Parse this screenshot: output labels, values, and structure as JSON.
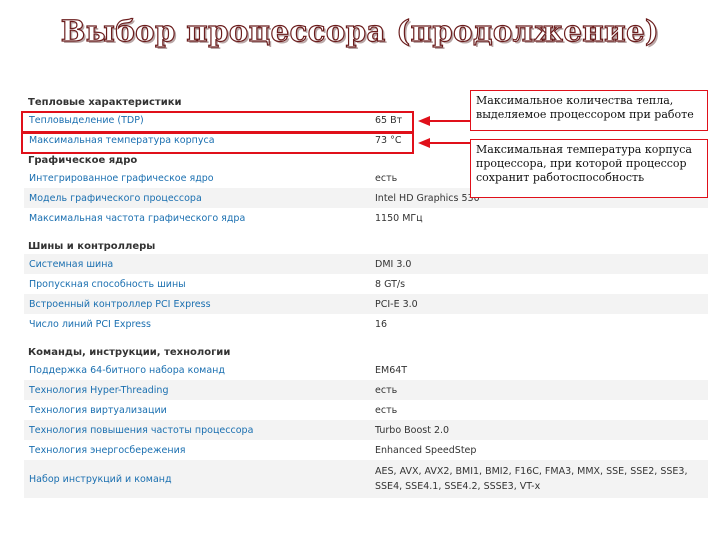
{
  "slide": {
    "title": "Выбор процессора (продолжение)"
  },
  "callouts": [
    {
      "text": "Максимальное количества тепла, выделяемое процессором при работе"
    },
    {
      "text": "Максимальная температура корпуса процессора, при которой процессор сохранит работоспособность"
    }
  ],
  "spec": {
    "thermal": {
      "header": "Тепловые характеристики",
      "rows": [
        {
          "name": "Тепловыделение (TDP)",
          "value": "65 Вт"
        },
        {
          "name": "Максимальная температура корпуса",
          "value": "73 °C"
        }
      ]
    },
    "graphics": {
      "header": "Графическое ядро",
      "rows": [
        {
          "name": "Интегрированное графическое ядро",
          "value": "есть"
        },
        {
          "name": "Модель графического процессора",
          "value": "Intel HD Graphics 530"
        },
        {
          "name": "Максимальная частота графического ядра",
          "value": "1150 МГц"
        }
      ]
    },
    "bus": {
      "header": "Шины и контроллеры",
      "rows": [
        {
          "name": "Системная шина",
          "value": "DMI 3.0"
        },
        {
          "name": "Пропускная способность шины",
          "value": "8 GT/s"
        },
        {
          "name": "Встроенный контроллер PCI Express",
          "value": "PCI-E 3.0"
        },
        {
          "name": "Число линий PCI Express",
          "value": "16"
        }
      ]
    },
    "commands": {
      "header": "Команды, инструкции, технологии",
      "rows": [
        {
          "name": "Поддержка 64-битного набора команд",
          "value": "EM64T"
        },
        {
          "name": "Технология Hyper-Threading",
          "value": "есть"
        },
        {
          "name": "Технология виртуализации",
          "value": "есть"
        },
        {
          "name": "Технология повышения частоты процессора",
          "value": "Turbo Boost 2.0"
        },
        {
          "name": "Технология энергосбережения",
          "value": "Enhanced SpeedStep"
        },
        {
          "name": "Набор инструкций и команд",
          "value": "AES, AVX, AVX2, BMI1, BMI2, F16C, FMA3, MMX, SSE, SSE2, SSE3, SSE4, SSE4.1, SSE4.2, SSSE3, VT-x"
        }
      ]
    }
  }
}
